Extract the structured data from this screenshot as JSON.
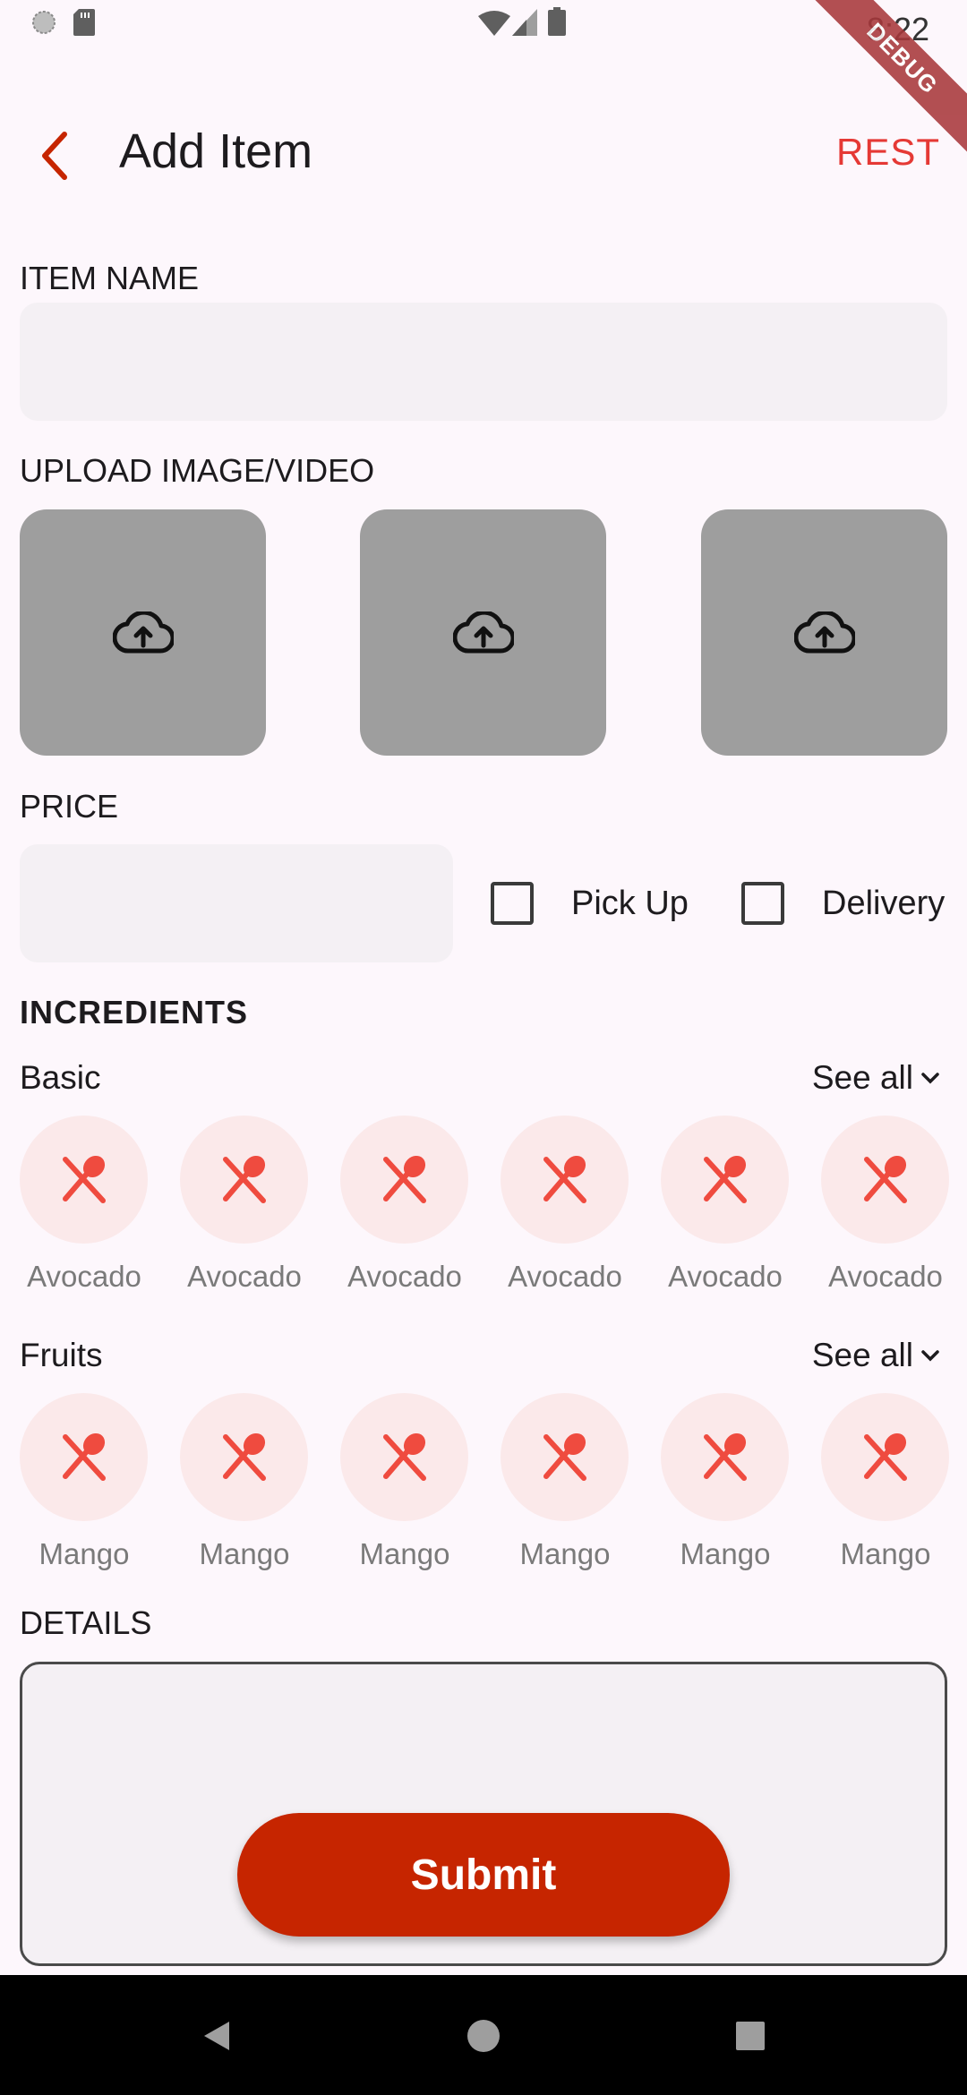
{
  "status_bar": {
    "time": "8:22"
  },
  "debug_banner": "DEBUG",
  "app_bar": {
    "title": "Add Item",
    "action_label": "REST"
  },
  "form": {
    "item_name_label": "ITEM NAME",
    "item_name_value": "",
    "upload_label": "UPLOAD IMAGE/VIDEO",
    "upload_slots": 3,
    "price_label": "PRICE",
    "price_value": "",
    "pickup_label": "Pick Up",
    "pickup_checked": false,
    "delivery_label": "Delivery",
    "delivery_checked": false,
    "ingredients_title": "INCREDIENTS",
    "groups": [
      {
        "name": "Basic",
        "see_all": "See all",
        "items": [
          "Avocado",
          "Avocado",
          "Avocado",
          "Avocado",
          "Avocado",
          "Avocado"
        ]
      },
      {
        "name": "Fruits",
        "see_all": "See all",
        "items": [
          "Mango",
          "Mango",
          "Mango",
          "Mango",
          "Mango",
          "Mango"
        ]
      }
    ],
    "details_label": "DETAILS",
    "details_value": "",
    "submit_label": "Submit"
  },
  "colors": {
    "accent": "#c62500",
    "reset": "#e53935",
    "icon": "#ef4b3f",
    "icon_bg": "#fbe9ea",
    "background": "#fdf7fc"
  },
  "icons": {
    "back": "chevron-left-icon",
    "upload": "cloud-upload-icon",
    "ingredient": "utensils-icon",
    "see_all": "chevron-down-icon"
  }
}
